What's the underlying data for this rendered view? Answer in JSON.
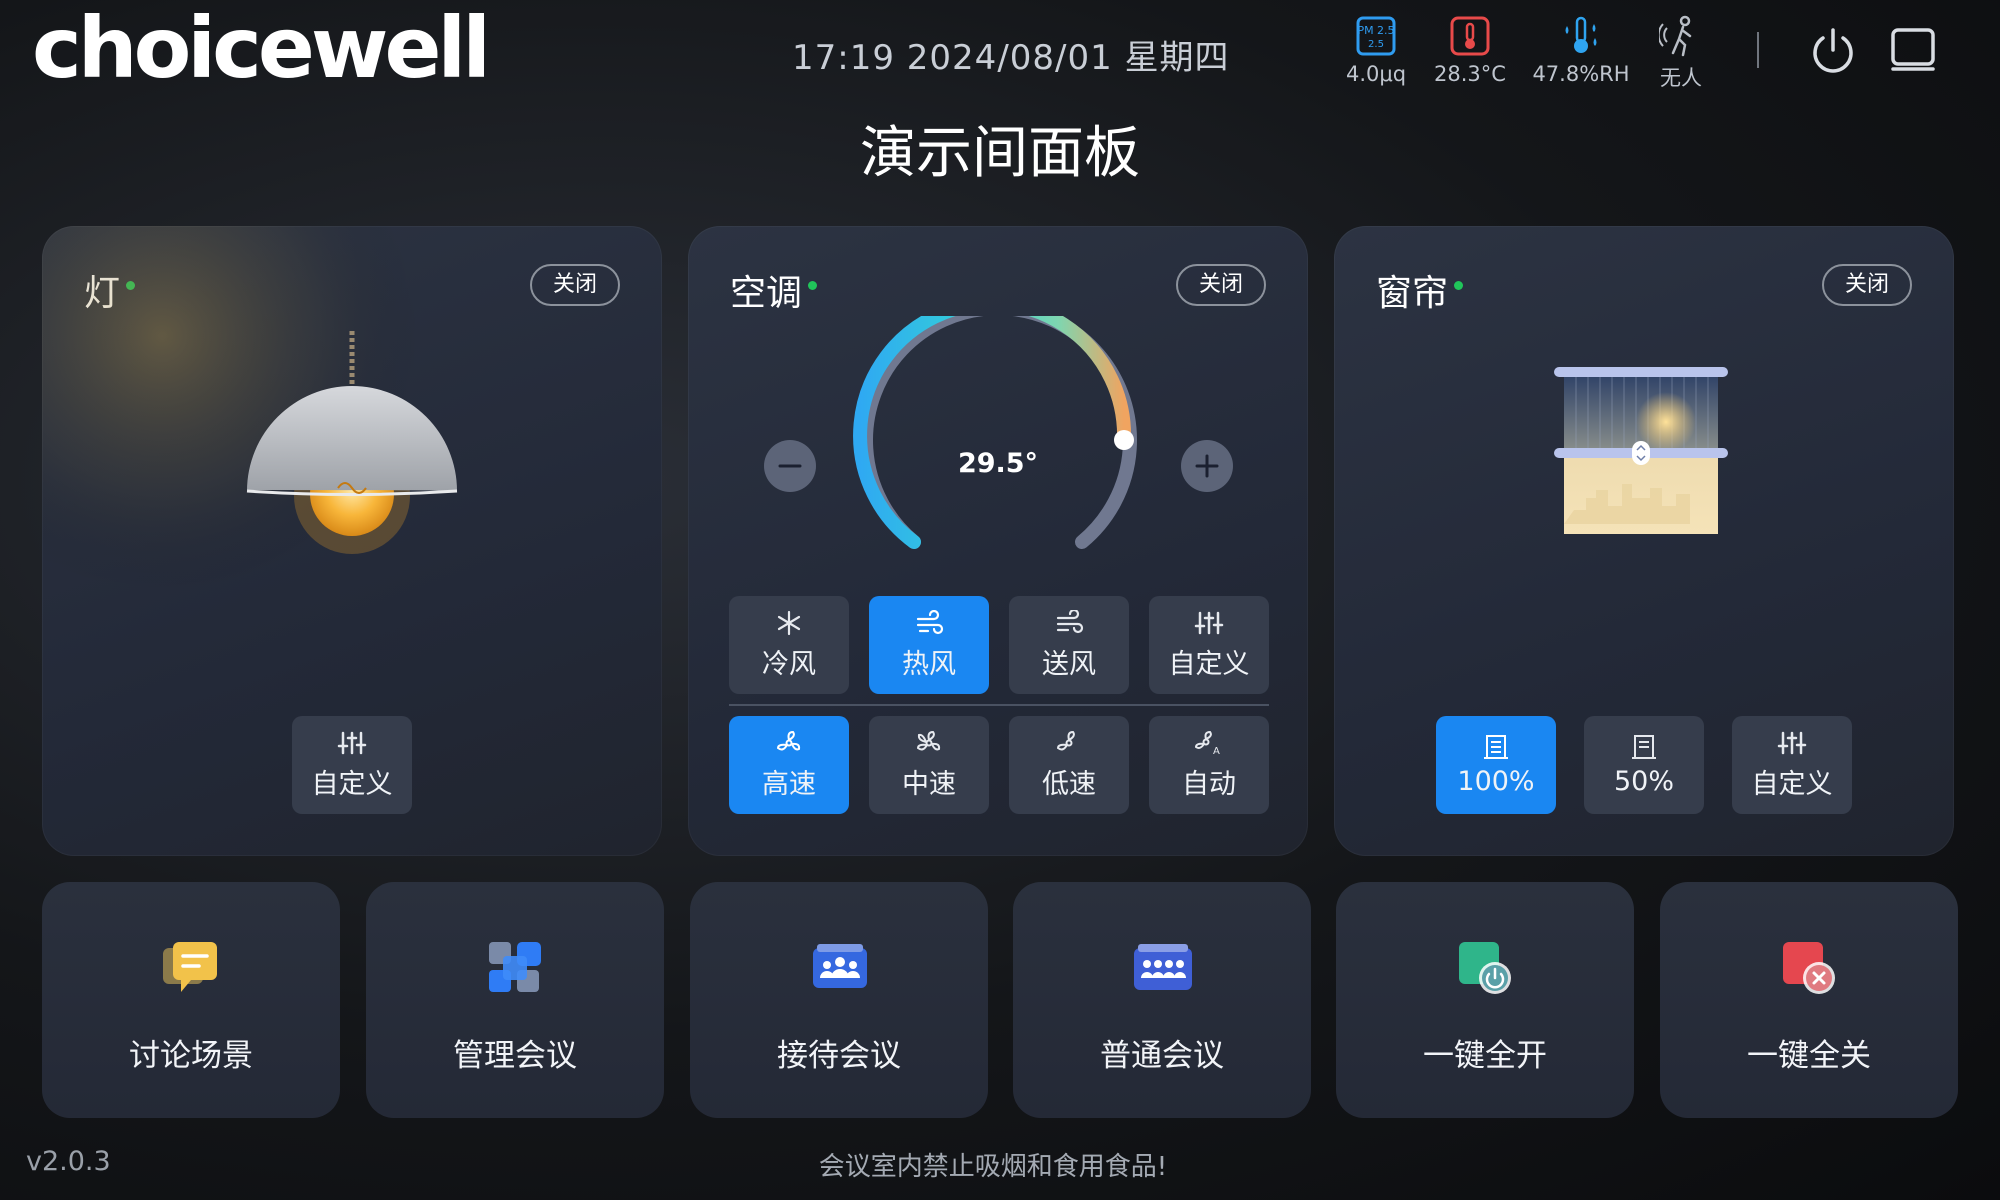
{
  "header": {
    "logo_text": "choicewell",
    "datetime": "17:19 2024/08/01 星期四",
    "page_title": "演示间面板",
    "sensors": [
      {
        "icon": "pm25-icon",
        "badge": "PM 2.5",
        "value": "4.0μq"
      },
      {
        "icon": "thermometer-icon",
        "value": "28.3°C"
      },
      {
        "icon": "humidity-icon",
        "value": "47.8%RH"
      },
      {
        "icon": "presence-icon",
        "value": "无人"
      }
    ],
    "actions": [
      {
        "icon": "power-icon"
      },
      {
        "icon": "screen-icon"
      }
    ]
  },
  "light": {
    "title": "灯",
    "status": "on",
    "close_label": "关闭",
    "custom_label": "自定义"
  },
  "ac": {
    "title": "空调",
    "status": "on",
    "close_label": "关闭",
    "temperature": "29.5°",
    "modes": [
      {
        "label": "冷风",
        "icon": "snowflake-icon",
        "active": false
      },
      {
        "label": "热风",
        "icon": "hot-wind-icon",
        "active": true
      },
      {
        "label": "送风",
        "icon": "wind-icon",
        "active": false
      },
      {
        "label": "自定义",
        "icon": "sliders-icon",
        "active": false
      }
    ],
    "speeds": [
      {
        "label": "高速",
        "icon": "fan-high-icon",
        "active": true
      },
      {
        "label": "中速",
        "icon": "fan-mid-icon",
        "active": false
      },
      {
        "label": "低速",
        "icon": "fan-low-icon",
        "active": false
      },
      {
        "label": "自动",
        "icon": "fan-auto-icon",
        "active": false
      }
    ]
  },
  "curtain": {
    "title": "窗帘",
    "status": "on",
    "close_label": "关闭",
    "buttons": [
      {
        "label": "100%",
        "icon": "curtain-icon",
        "active": true
      },
      {
        "label": "50%",
        "icon": "curtain-icon",
        "active": false
      },
      {
        "label": "自定义",
        "icon": "sliders-icon",
        "active": false
      }
    ]
  },
  "scenes": [
    {
      "label": "讨论场景",
      "icon": "chat-icon"
    },
    {
      "label": "管理会议",
      "icon": "grid-icon"
    },
    {
      "label": "接待会议",
      "icon": "reception-icon"
    },
    {
      "label": "普通会议",
      "icon": "meeting-icon"
    },
    {
      "label": "一键全开",
      "icon": "all-on-icon"
    },
    {
      "label": "一键全关",
      "icon": "all-off-icon"
    }
  ],
  "footer": {
    "version": "v2.0.3",
    "notice": "会议室内禁止吸烟和食用食品!"
  },
  "colors": {
    "accent": "#1a87f2",
    "status_on": "#20c55a",
    "card_bg": "#262c3a",
    "tile_bg": "#363d4c"
  }
}
